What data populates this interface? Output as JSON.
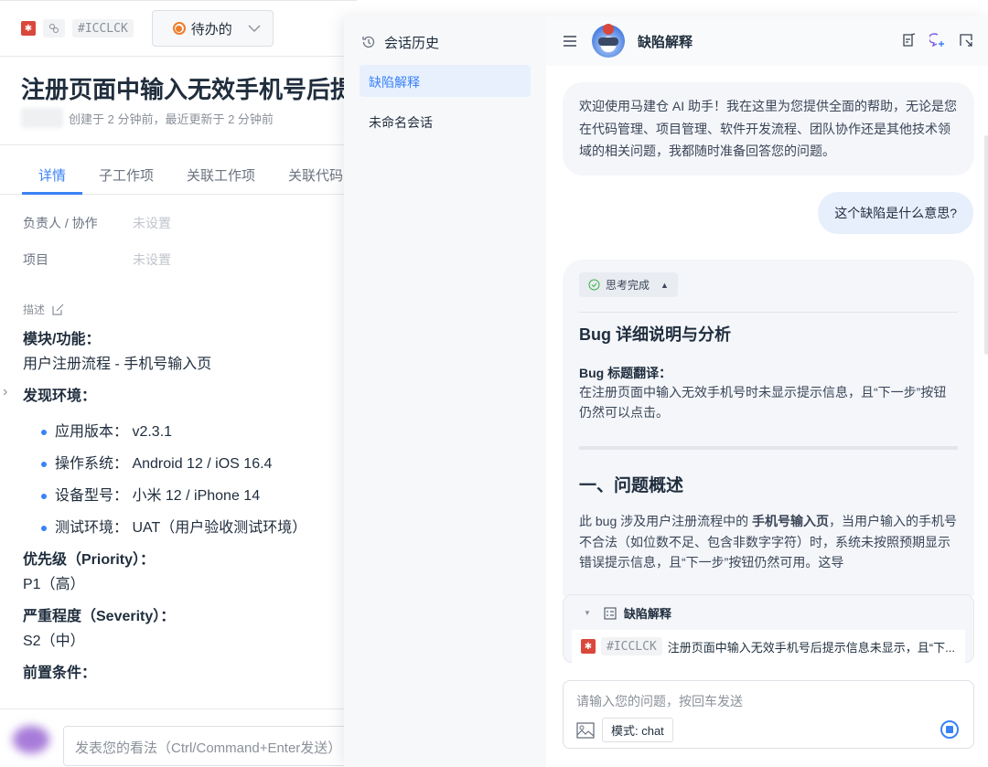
{
  "issue": {
    "id": "#ICCLCK",
    "status": "待办的",
    "title": "注册页面中输入无效手机号后提",
    "meta": "创建于 2 分钟前，最近更新于 2 分钟前",
    "tabs": [
      "详情",
      "子工作项",
      "关联工作项",
      "关联代码"
    ],
    "fields": [
      {
        "label": "负责人 / 协作",
        "value": "未设置"
      },
      {
        "label": "项目",
        "value": "未设置"
      }
    ],
    "desc_label": "描述",
    "module_label": "模块/功能：",
    "module_value": "用户注册流程 - 手机号输入页",
    "env_label": "发现环境：",
    "env_items": [
      "应用版本：  v2.3.1",
      "操作系统：  Android 12 / iOS 16.4",
      "设备型号：  小米 12 / iPhone 14",
      "测试环境：  UAT（用户验收测试环境）"
    ],
    "priority_label": "优先级（Priority）：",
    "priority_value": "P1（高）",
    "severity_label": "严重程度（Severity）：",
    "severity_value": "S2（中）",
    "precondition_label": "前置条件：",
    "comment_placeholder": "发表您的看法（Ctrl/Command+Enter发送）"
  },
  "history": {
    "title": "会话历史",
    "items": [
      "缺陷解释",
      "未命名会话"
    ]
  },
  "chat": {
    "title": "缺陷解释",
    "welcome": "欢迎使用马建仓 AI 助手！我在这里为您提供全面的帮助，无论是您在代码管理、项目管理、软件开发流程、团队协作还是其他技术领域的相关问题，我都随时准备回答您的问题。",
    "user_msg": "这个缺陷是什么意思?",
    "thinking": "思考完成",
    "answer_title": "Bug 详细说明与分析",
    "answer_sub": "Bug 标题翻译：",
    "answer_translation": "在注册页面中输入无效手机号时未显示提示信息，且“下一步”按钮仍然可以点击。",
    "section1": "一、问题概述",
    "para_a": "此 bug 涉及用户注册流程中的 ",
    "para_bold": "手机号输入页",
    "para_b": "，当用户输入的手机号不合法（如位数不足、包含非数字字符）时，系统未按照预期显示错误提示信息，且“下一步”按钮仍然可用。这导",
    "context_title": "缺陷解释",
    "context_id": "#ICCLCK",
    "context_text": "注册页面中输入无效手机号后提示信息未显示，且“下...",
    "input_placeholder": "请输入您的问题，按回车发送",
    "mode": "模式: chat"
  },
  "colors": {
    "accent": "#3b82f6",
    "status": "#f07d2a",
    "bug": "#d9483b",
    "success": "#3bb34a"
  }
}
